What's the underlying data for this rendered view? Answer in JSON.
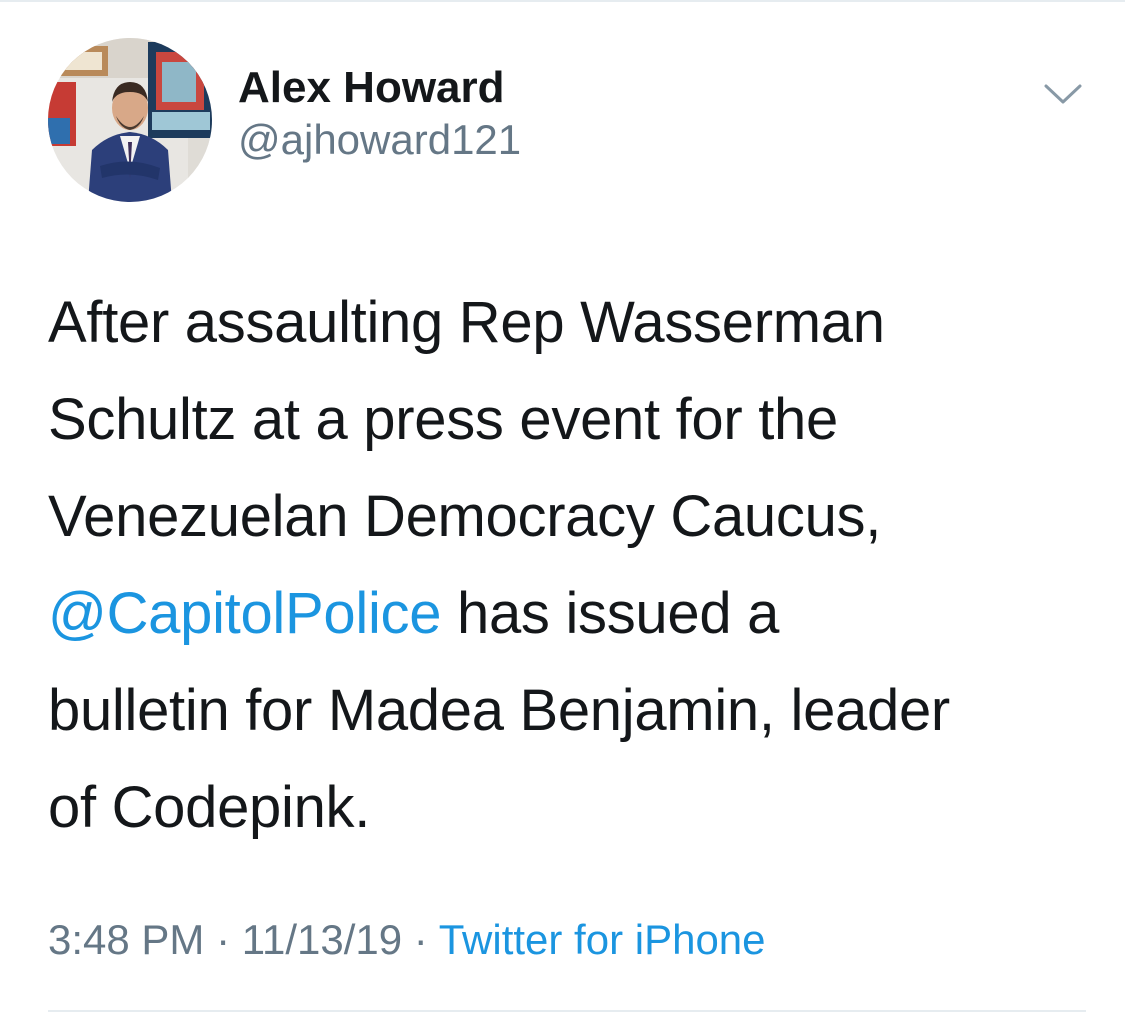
{
  "tweet": {
    "author": {
      "display_name": "Alex Howard",
      "handle": "@ajhoward121"
    },
    "text": {
      "line1": "After assaulting Rep Wasserman",
      "line2": "Schultz at a press event for the",
      "line3": "Venezuelan Democracy Caucus,",
      "line4_mention": "@CapitolPolice",
      "line4_rest": " has issued a",
      "line5": "bulletin for Madea Benjamin, leader",
      "line6": "of Codepink."
    },
    "meta": {
      "time": "3:48 PM",
      "separator": " · ",
      "date": "11/13/19",
      "source": "Twitter for iPhone"
    },
    "menu_icon": "chevron-down-icon"
  },
  "colors": {
    "link": "#1b95e0",
    "secondary": "#657786",
    "primary_text": "#14171a",
    "divider": "#e6ecf0"
  }
}
